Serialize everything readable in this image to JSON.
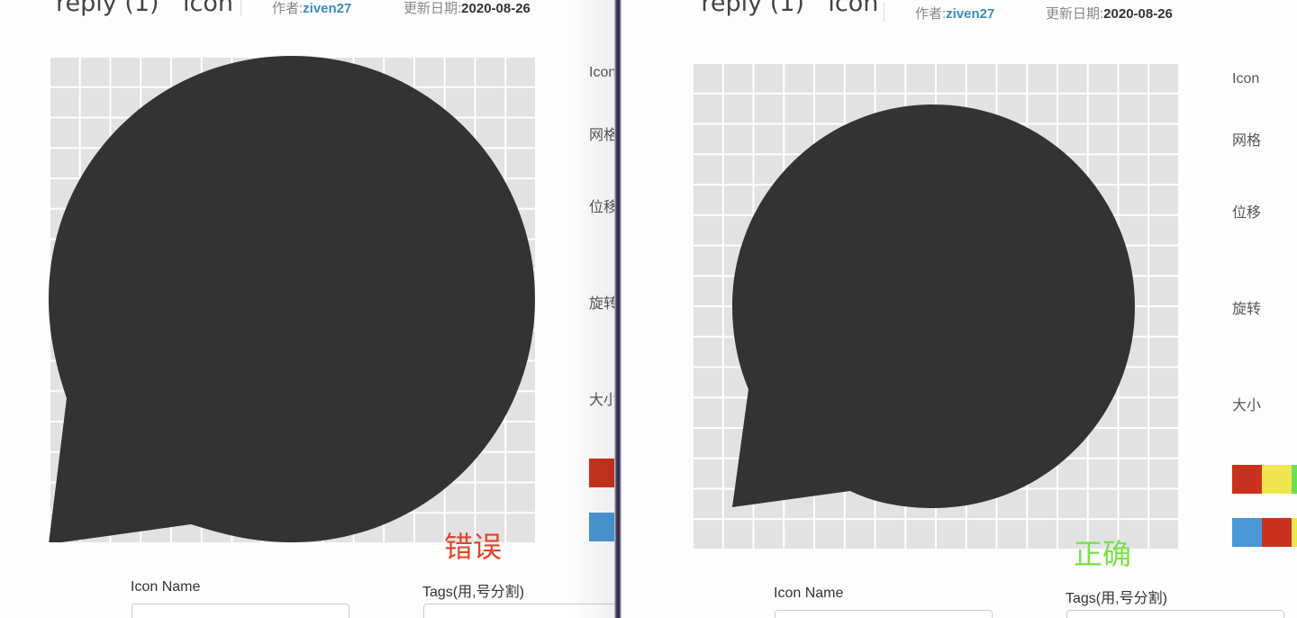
{
  "left": {
    "title": "reply (1)\"",
    "title_suffix": "icon",
    "author_label": "作者:",
    "author": "ziven27",
    "date_label": "更新日期:",
    "date": "2020-08-26",
    "side_labels": [
      "Icon",
      "网格",
      "位移",
      "旋转",
      "大小"
    ],
    "verdict": "错误",
    "verdict_color": "#e0452b",
    "form": {
      "name_label": "Icon Name",
      "tags_label": "Tags(用,号分割)"
    }
  },
  "right": {
    "title": "\"reply (1)\"",
    "title_suffix": "icon",
    "author_label": "作者:",
    "author": "ziven27",
    "date_label": "更新日期:",
    "date": "2020-08-26",
    "side_labels": [
      "Icon",
      "网格",
      "位移",
      "旋转",
      "大小"
    ],
    "verdict": "正确",
    "verdict_color": "#7be04a",
    "form": {
      "name_label": "Icon Name",
      "tags_label": "Tags(用,号分割)"
    }
  },
  "colors": {
    "icon_fill": "#333333",
    "grid_bg": "#e2e2e2",
    "swatch_red": "#c8321e",
    "swatch_yellow": "#efe64f",
    "swatch_green": "#6be052",
    "swatch_blue": "#4a97d6"
  },
  "icons": {
    "preview": "reply-bubble-icon"
  }
}
